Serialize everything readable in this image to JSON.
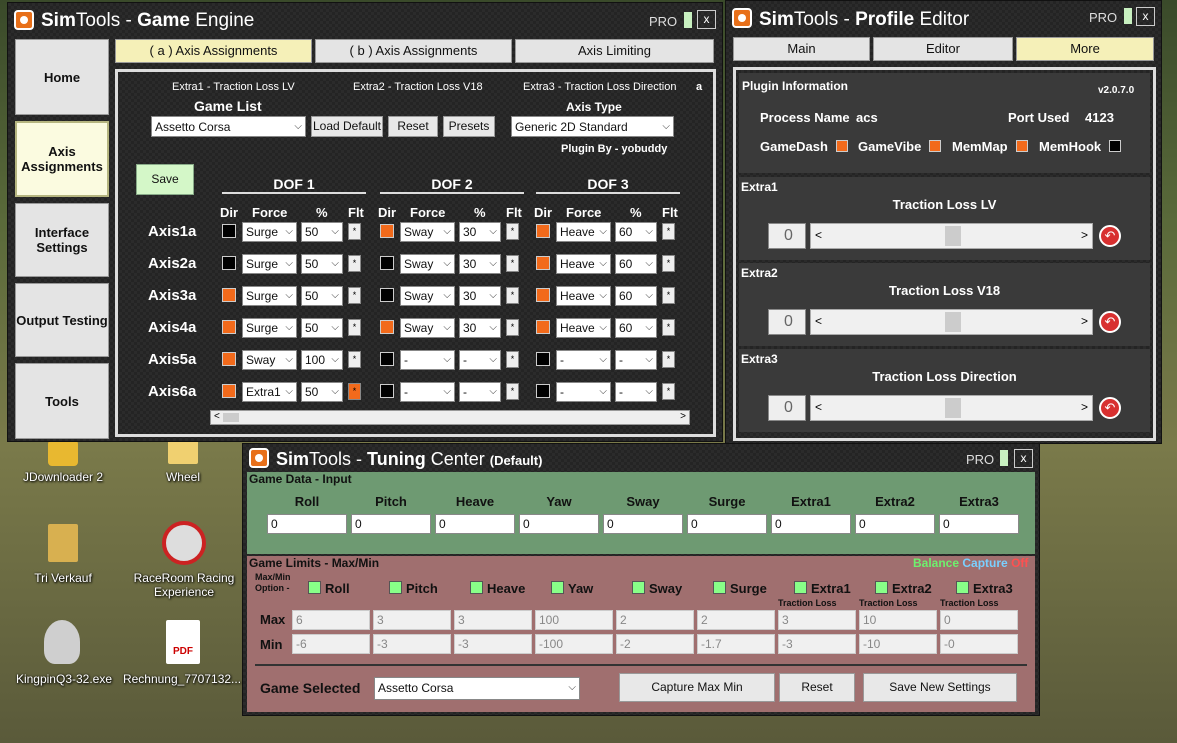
{
  "desktop": [
    {
      "label": "JDownloader 2"
    },
    {
      "label": "Wheel"
    },
    {
      "label": "Tri Verkauf"
    },
    {
      "label": "RaceRoom Racing Experience"
    },
    {
      "label": "KingpinQ3-32.exe"
    },
    {
      "label": "Rechnung_7707132..."
    },
    {
      "pdf_label": "PDF"
    }
  ],
  "game_engine": {
    "title_a": "Sim",
    "title_b": "Tools",
    "title_c": " - ",
    "title_d": "Game",
    "title_e": " Engine",
    "pro": "PRO",
    "close": "x",
    "nav": [
      "Home",
      "Axis Assignments",
      "Interface Settings",
      "Output Testing",
      "Tools"
    ],
    "tabs": [
      "( a ) Axis Assignments",
      "( b ) Axis Assignments",
      "Axis Limiting"
    ],
    "extras": [
      "Extra1 - Traction Loss LV",
      "Extra2 - Traction Loss V18",
      "Extra3 - Traction Loss Direction",
      "a"
    ],
    "game_list_label": "Game List",
    "game_selected": "Assetto Corsa",
    "load_default": "Load Default",
    "reset": "Reset",
    "presets": "Presets",
    "axis_type_label": "Axis Type",
    "axis_type": "Generic 2D Standard",
    "plugin_by": "Plugin By - yobuddy",
    "save": "Save",
    "dof": [
      "DOF 1",
      "DOF 2",
      "DOF 3"
    ],
    "col_dir": "Dir",
    "col_force": "Force",
    "col_pct": "%",
    "col_flt": "Flt",
    "flt_mark": "*",
    "rows": [
      {
        "axis": "Axis1a",
        "c": [
          {
            "dir": false,
            "force": "Surge",
            "pct": "50"
          },
          {
            "dir": true,
            "force": "Sway",
            "pct": "30"
          },
          {
            "dir": true,
            "force": "Heave",
            "pct": "60"
          }
        ]
      },
      {
        "axis": "Axis2a",
        "c": [
          {
            "dir": false,
            "force": "Surge",
            "pct": "50"
          },
          {
            "dir": false,
            "force": "Sway",
            "pct": "30"
          },
          {
            "dir": true,
            "force": "Heave",
            "pct": "60"
          }
        ]
      },
      {
        "axis": "Axis3a",
        "c": [
          {
            "dir": true,
            "force": "Surge",
            "pct": "50"
          },
          {
            "dir": false,
            "force": "Sway",
            "pct": "30"
          },
          {
            "dir": true,
            "force": "Heave",
            "pct": "60"
          }
        ]
      },
      {
        "axis": "Axis4a",
        "c": [
          {
            "dir": true,
            "force": "Surge",
            "pct": "50"
          },
          {
            "dir": true,
            "force": "Sway",
            "pct": "30"
          },
          {
            "dir": true,
            "force": "Heave",
            "pct": "60"
          }
        ]
      },
      {
        "axis": "Axis5a",
        "c": [
          {
            "dir": true,
            "force": "Sway",
            "pct": "100"
          },
          {
            "dir": false,
            "force": "-",
            "pct": "-"
          },
          {
            "dir": false,
            "force": "-",
            "pct": "-"
          }
        ]
      },
      {
        "axis": "Axis6a",
        "c": [
          {
            "dir": true,
            "force": "Extra1",
            "pct": "50",
            "flt": true
          },
          {
            "dir": false,
            "force": "-",
            "pct": "-"
          },
          {
            "dir": false,
            "force": "-",
            "pct": "-"
          }
        ]
      }
    ]
  },
  "profile_editor": {
    "title_a": "Sim",
    "title_b": "Tools",
    "title_c": " - ",
    "title_d": "Profile",
    "title_e": " Editor",
    "pro": "PRO",
    "close": "x",
    "tabs": [
      "Main",
      "Editor",
      "More"
    ],
    "plugin_info": "Plugin Information",
    "version": "v2.0.7.0",
    "process_label": "Process Name",
    "process": "acs",
    "port_label": "Port Used",
    "port": "4123",
    "flags": [
      {
        "label": "GameDash",
        "on": true
      },
      {
        "label": "GameVibe",
        "on": true
      },
      {
        "label": "MemMap",
        "on": true
      },
      {
        "label": "MemHook",
        "on": false
      }
    ],
    "extras": [
      {
        "head": "Extra1",
        "title": "Traction Loss LV",
        "value": "0"
      },
      {
        "head": "Extra2",
        "title": "Traction Loss V18",
        "value": "0"
      },
      {
        "head": "Extra3",
        "title": "Traction Loss Direction",
        "value": "0"
      }
    ],
    "left_arrow": "<",
    "right_arrow": ">"
  },
  "tuning": {
    "title_a": "Sim",
    "title_b": "Tools",
    "title_c": " - ",
    "title_d": "Tuning",
    "title_e": " Center",
    "title_f": "(Default)",
    "pro": "PRO",
    "close": "x",
    "game_data_label": "Game Data - Input",
    "cols": [
      "Roll",
      "Pitch",
      "Heave",
      "Yaw",
      "Sway",
      "Surge",
      "Extra1",
      "Extra2",
      "Extra3"
    ],
    "inputs": [
      "0",
      "0",
      "0",
      "0",
      "0",
      "0",
      "0",
      "0",
      "0"
    ],
    "limits_label": "Game Limits - Max/Min",
    "balance": "Balance",
    "capture": "Capture",
    "off": "Off",
    "maxmin_option": "Max/Min Option -",
    "traction_loss": "Traction Loss",
    "max_label": "Max",
    "min_label": "Min",
    "max": [
      "6",
      "3",
      "3",
      "100",
      "2",
      "2",
      "3",
      "10",
      "0"
    ],
    "min": [
      "-6",
      "-3",
      "-3",
      "-100",
      "-2",
      "-1.7",
      "-3",
      "-10",
      "-0"
    ],
    "game_selected_label": "Game Selected",
    "game_selected": "Assetto Corsa",
    "capture_btn": "Capture Max Min",
    "reset_btn": "Reset",
    "save_btn": "Save New Settings"
  }
}
